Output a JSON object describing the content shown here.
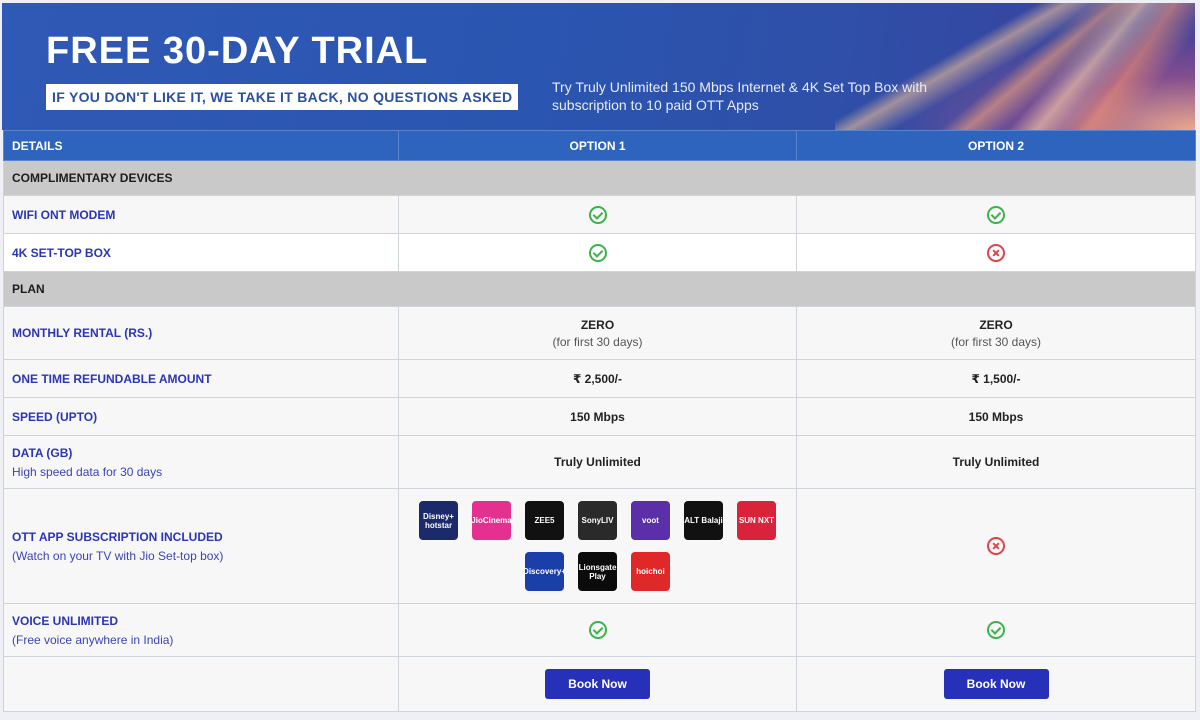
{
  "banner": {
    "title": "FREE 30-DAY TRIAL",
    "tagline": "IF YOU DON'T LIKE IT, WE TAKE IT BACK, NO QUESTIONS ASKED",
    "description": "Try Truly Unlimited 150 Mbps Internet & 4K Set Top Box with subscription to 10 paid OTT Apps"
  },
  "table": {
    "headers": [
      "DETAILS",
      "OPTION 1",
      "OPTION 2"
    ],
    "sections": {
      "devices": "COMPLIMENTARY DEVICES",
      "plan": "PLAN"
    },
    "rows": {
      "wifi": {
        "label": "WIFI ONT MODEM",
        "opt1": "check-icon",
        "opt2": "check-icon"
      },
      "stb": {
        "label": "4K SET-TOP BOX",
        "opt1": "check-icon",
        "opt2": "cross-icon"
      },
      "rental": {
        "label": "MONTHLY RENTAL (RS.)",
        "opt1": "ZERO",
        "opt1_note": "(for first 30 days)",
        "opt2": "ZERO",
        "opt2_note": "(for first 30 days)"
      },
      "refundable": {
        "label": "ONE TIME REFUNDABLE AMOUNT",
        "opt1": "₹ 2,500/-",
        "opt2": "₹ 1,500/-"
      },
      "speed": {
        "label": "SPEED (UPTO)",
        "opt1": "150 Mbps",
        "opt2": "150 Mbps"
      },
      "data": {
        "label": "DATA (GB)",
        "sub": "High speed data for 30 days",
        "opt1": "Truly Unlimited",
        "opt2": "Truly Unlimited"
      },
      "ott": {
        "label": "OTT APP SUBSCRIPTION INCLUDED",
        "sub": "(Watch on your TV with Jio Set-top box)",
        "apps": [
          {
            "name": "Disney+ hotstar",
            "color": "#1a2a6b"
          },
          {
            "name": "JioCinema",
            "color": "#e4308f"
          },
          {
            "name": "ZEE5",
            "color": "#111111"
          },
          {
            "name": "SonyLIV",
            "color": "#2a2a2a"
          },
          {
            "name": "voot",
            "color": "#5b2fa8"
          },
          {
            "name": "ALT Balaji",
            "color": "#111111"
          },
          {
            "name": "SUN NXT",
            "color": "#d8233a"
          },
          {
            "name": "Discovery+",
            "color": "#1b3fa8"
          },
          {
            "name": "Lionsgate Play",
            "color": "#0b0b0b"
          },
          {
            "name": "hoichoi",
            "color": "#e02828"
          }
        ],
        "opt2": "cross-icon"
      },
      "voice": {
        "label": "VOICE UNLIMITED",
        "sub": "(Free voice anywhere in India)",
        "opt1": "check-icon",
        "opt2": "check-icon"
      }
    },
    "book_label": "Book Now"
  }
}
